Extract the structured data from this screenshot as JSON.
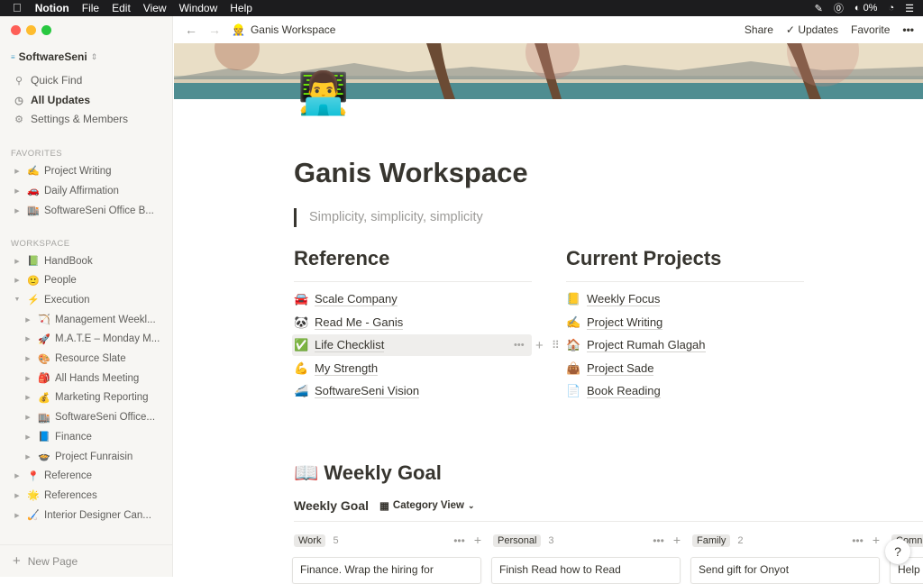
{
  "menubar": {
    "apple": "",
    "app": "Notion",
    "items": [
      "File",
      "Edit",
      "View",
      "Window",
      "Help"
    ],
    "battery": "0%"
  },
  "sidebar": {
    "workspace": "SoftwareSeni",
    "workspace_logo": "softwareseni",
    "nav": [
      {
        "label": "Quick Find",
        "icon": "search-icon"
      },
      {
        "label": "All Updates",
        "icon": "clock-icon"
      },
      {
        "label": "Settings & Members",
        "icon": "gear-icon"
      }
    ],
    "favorites_heading": "FAVORITES",
    "favorites": [
      {
        "emoji": "✍️",
        "label": "Project Writing"
      },
      {
        "emoji": "🚗",
        "label": "Daily Affirmation"
      },
      {
        "emoji": "🏬",
        "label": "SoftwareSeni Office B..."
      }
    ],
    "workspace_heading": "WORKSPACE",
    "workspace_items": [
      {
        "emoji": "📗",
        "label": "HandBook",
        "indent": 0,
        "open": false
      },
      {
        "emoji": "🙂",
        "label": "People",
        "indent": 0,
        "open": false
      },
      {
        "emoji": "⚡",
        "label": "Execution",
        "indent": 0,
        "open": true
      },
      {
        "emoji": "🏹",
        "label": "Management Weekl...",
        "indent": 1,
        "open": false
      },
      {
        "emoji": "🚀",
        "label": "M.A.T.E – Monday M...",
        "indent": 1,
        "open": false
      },
      {
        "emoji": "🎨",
        "label": "Resource Slate",
        "indent": 1,
        "open": false
      },
      {
        "emoji": "🎒",
        "label": "All Hands Meeting",
        "indent": 1,
        "open": false
      },
      {
        "emoji": "💰",
        "label": "Marketing Reporting",
        "indent": 1,
        "open": false
      },
      {
        "emoji": "🏬",
        "label": "SoftwareSeni Office...",
        "indent": 1,
        "open": false
      },
      {
        "emoji": "📘",
        "label": "Finance",
        "indent": 1,
        "open": false
      },
      {
        "emoji": "🍲",
        "label": "Project Funraisin",
        "indent": 1,
        "open": false
      },
      {
        "emoji": "📍",
        "label": "Reference",
        "indent": 0,
        "open": false
      },
      {
        "emoji": "🌟",
        "label": "References",
        "indent": 0,
        "open": false
      },
      {
        "emoji": "🏑",
        "label": "Interior Designer Can...",
        "indent": 0,
        "open": false
      }
    ],
    "new_page": "New Page"
  },
  "topbar": {
    "breadcrumb_emoji": "👷",
    "breadcrumb": "Ganis Workspace",
    "share": "Share",
    "updates": "Updates",
    "favorite": "Favorite",
    "more": "•••"
  },
  "page": {
    "icon": "👨‍💻",
    "title": "Ganis Workspace",
    "quote": "Simplicity, simplicity, simplicity",
    "reference": {
      "heading": "Reference",
      "links": [
        {
          "emoji": "🚘",
          "label": "Scale Company"
        },
        {
          "emoji": "🐼",
          "label": "Read Me - Ganis"
        },
        {
          "emoji": "✅",
          "label": "Life Checklist"
        },
        {
          "emoji": "💪",
          "label": "My Strength"
        },
        {
          "emoji": "🚄",
          "label": "SoftwareSeni Vision"
        }
      ]
    },
    "projects": {
      "heading": "Current Projects",
      "links": [
        {
          "emoji": "📒",
          "label": "Weekly Focus"
        },
        {
          "emoji": "✍️",
          "label": "Project Writing"
        },
        {
          "emoji": "🏠",
          "label": "Project Rumah Glagah"
        },
        {
          "emoji": "👜",
          "label": "Project Sade"
        },
        {
          "emoji": "📄",
          "label": "Book Reading"
        }
      ]
    },
    "weekly_goal": {
      "emoji": "📖",
      "heading": "Weekly Goal",
      "sub": "Weekly Goal",
      "view": "Category View",
      "groups": [
        {
          "tag": "Work",
          "count": "5",
          "card": "Finance. Wrap the hiring for"
        },
        {
          "tag": "Personal",
          "count": "3",
          "card": "Finish Read how to Read"
        },
        {
          "tag": "Family",
          "count": "2",
          "card": "Send gift for Onyot"
        },
        {
          "tag": "Comn",
          "count": "",
          "card": "Help"
        }
      ]
    }
  },
  "help": "?"
}
